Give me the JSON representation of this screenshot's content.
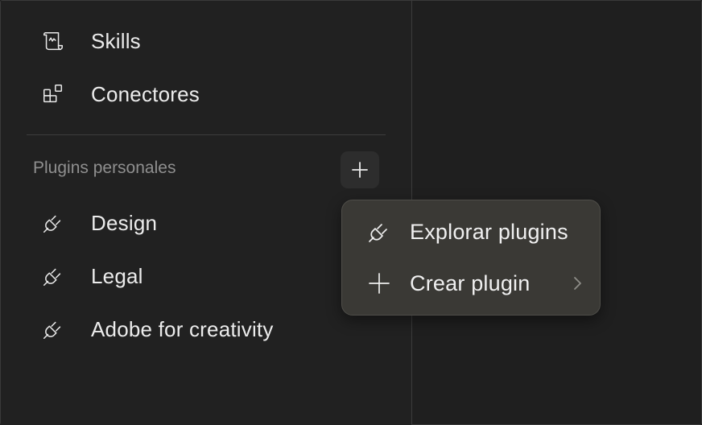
{
  "sidebar": {
    "nav": [
      {
        "label": "Skills",
        "icon": "scroll-icon"
      },
      {
        "label": "Conectores",
        "icon": "grid-squares-icon"
      }
    ],
    "section_label": "Plugins personales",
    "plugins": [
      {
        "label": "Design",
        "icon": "plug-icon"
      },
      {
        "label": "Legal",
        "icon": "plug-icon"
      },
      {
        "label": "Adobe for creativity",
        "icon": "plug-icon"
      }
    ]
  },
  "popover": {
    "items": [
      {
        "label": "Explorar plugins",
        "icon": "plug-icon"
      },
      {
        "label": "Crear plugin",
        "icon": "plus-icon",
        "submenu_icon": "chevron-right-icon"
      }
    ]
  },
  "colors": {
    "background": "#202020",
    "popover": "#3a3935",
    "text": "#ececec",
    "muted": "#8f8f8f"
  }
}
